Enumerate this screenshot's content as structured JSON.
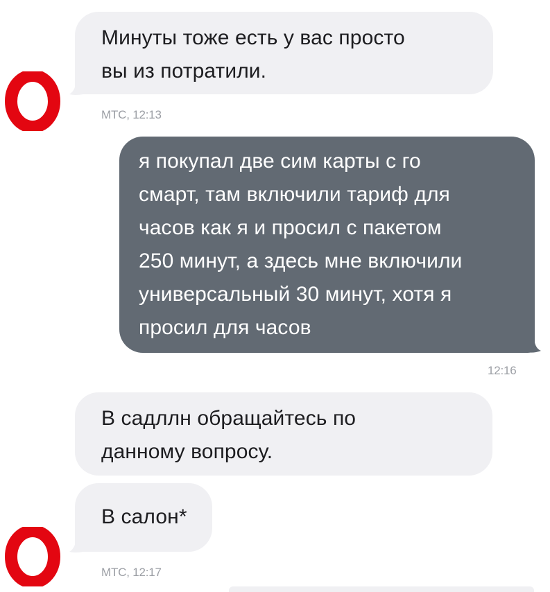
{
  "sender_name": "МТС",
  "colors": {
    "incoming_bubble": "#f0f0f3",
    "outgoing_bubble": "#626a73",
    "brand_red": "#e30611",
    "meta_text": "#9b9ea4"
  },
  "avatar_icon": "mts-logo-icon",
  "messages": [
    {
      "direction": "incoming",
      "text": "Минуты тоже есть у вас просто\nвы из потратили.",
      "meta": "МТС, 12:13"
    },
    {
      "direction": "outgoing",
      "text": "я покупал две сим карты с го\nсмарт, там включили тариф для\nчасов как я и просил с пакетом\n250 минут, а здесь мне включили\nуниверсальный 30 минут, хотя я\nпросил для часов",
      "time": "12:16"
    },
    {
      "direction": "incoming",
      "text": "В садллн обращайтесь по\nданному вопросу."
    },
    {
      "direction": "incoming",
      "text": "В салон*",
      "meta": "МТС, 12:17"
    }
  ]
}
